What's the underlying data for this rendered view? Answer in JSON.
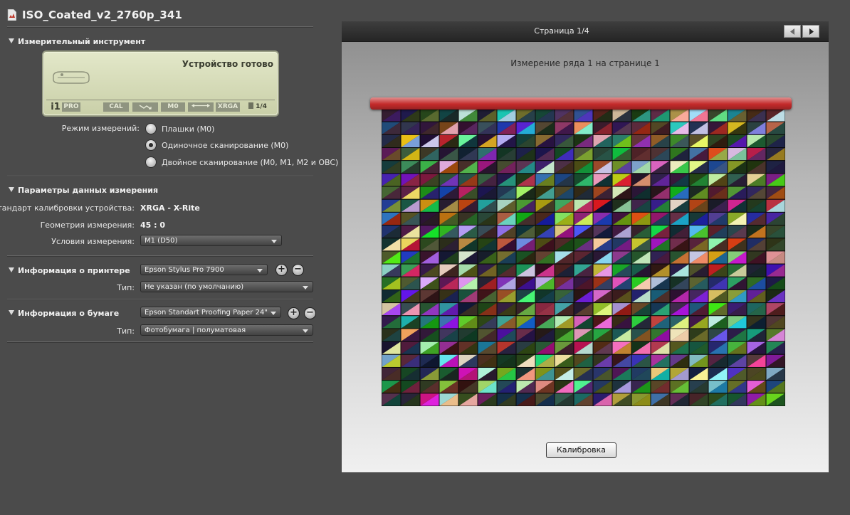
{
  "document": {
    "title": "ISO_Coated_v2_2760p_341"
  },
  "instrument_section": {
    "title": "Измерительный инструмент",
    "lcd": {
      "status": "Устройство готово",
      "brand": "i1",
      "model": "PRO",
      "cal": "CAL",
      "mode": "M0",
      "standard": "XRGA",
      "page": "1/4"
    },
    "mode_label": "Режим измерений:",
    "modes": [
      {
        "label": "Плашки (M0)",
        "selected": false
      },
      {
        "label": "Одиночное сканирование (M0)",
        "selected": true
      },
      {
        "label": "Двойное сканирование (M0, M1, M2 и OBC)",
        "selected": false
      }
    ]
  },
  "measurement_params": {
    "title": "Параметры данных измерения",
    "calibration_label": "Стандарт калибровки устройства:",
    "calibration_value": "XRGA - X-Rite",
    "geometry_label": "Геометрия измерения:",
    "geometry_value": "45 : 0",
    "conditions_label": "Условия измерения:",
    "conditions_value": "M1 (D50)"
  },
  "printer_info": {
    "title": "Информация о принтере",
    "printer_value": "Epson Stylus Pro 7900",
    "type_label": "Тип:",
    "type_value": "Не указан (по умолчанию)"
  },
  "paper_info": {
    "title": "Информация о бумаге",
    "paper_value": "Epson Standart Proofing Paper 24\"",
    "type_label": "Тип:",
    "type_value": "Фотобумага | полуматовая"
  },
  "preview": {
    "page_label": "Страница 1/4",
    "measure_label": "Измерение ряда 1 на странице 1",
    "calibrate_button": "Калибровка",
    "grid_cols": 21,
    "grid_rows": 23
  },
  "colors": {
    "accent_scan_bar": "#c82020",
    "app_background": "#4b4b4b"
  }
}
